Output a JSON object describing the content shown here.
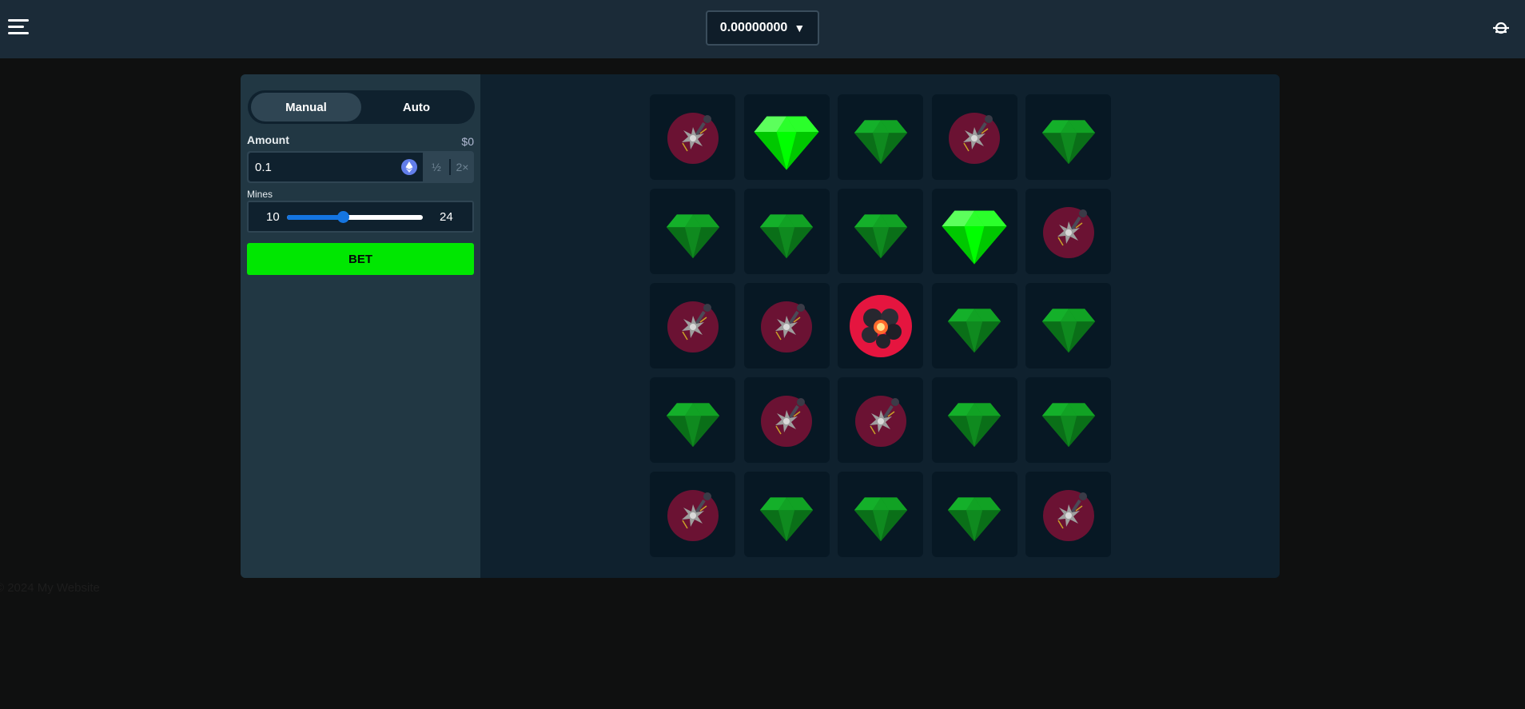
{
  "header": {
    "balance": "0.00000000",
    "balance_caret": "▼",
    "menu_icon": "hamburger-icon",
    "right_icon": "user-icon"
  },
  "sidebar": {
    "tabs": [
      {
        "label": "Manual",
        "active": true
      },
      {
        "label": "Auto",
        "active": false
      }
    ],
    "amount_label": "Amount",
    "amount_usd": "$0",
    "amount_value": "0.1",
    "currency_icon": "ethereum-icon",
    "half_label": "½",
    "double_label": "2×",
    "mines_label": "Mines",
    "mines_min": "10",
    "mines_max": "24",
    "mines_slider_fraction": 0.41,
    "bet_label": "BET"
  },
  "board": {
    "rows": 5,
    "cols": 5,
    "tiles": [
      "mine",
      "gem-revealed",
      "gem",
      "mine",
      "gem",
      "gem",
      "gem",
      "gem",
      "gem-revealed",
      "mine",
      "mine",
      "mine",
      "mine-exploded",
      "gem",
      "gem",
      "gem",
      "mine",
      "mine",
      "gem",
      "gem",
      "mine",
      "gem",
      "gem",
      "gem",
      "mine"
    ]
  },
  "colors": {
    "topbar": "#1b2b38",
    "panel": "#213743",
    "board_bg": "#0f212e",
    "tile": "#071824",
    "bet_green": "#00e701",
    "accent_blue": "#1475e1"
  },
  "footer": {
    "text": "© 2024 My Website"
  }
}
